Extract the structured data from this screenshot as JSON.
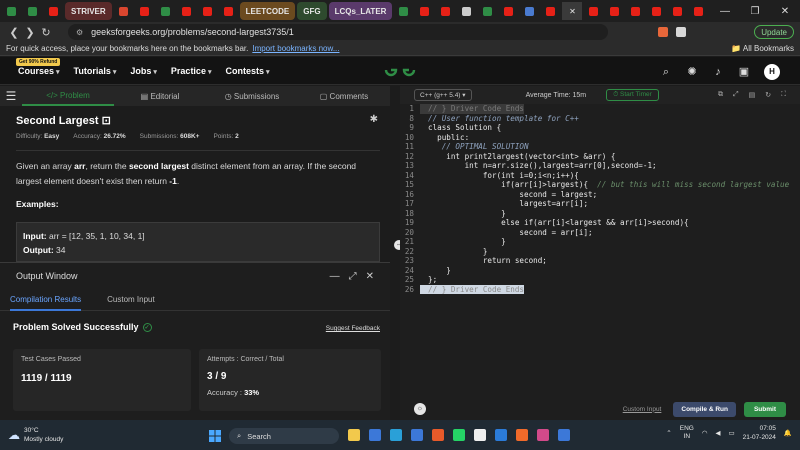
{
  "browser": {
    "tabs": [
      {
        "kind": "icon",
        "icon": "gfg-icon",
        "color": "#2f8d46"
      },
      {
        "kind": "icon",
        "icon": "gfg-icon",
        "color": "#2f8d46"
      },
      {
        "kind": "icon",
        "icon": "youtube-icon",
        "color": "#e62117"
      },
      {
        "kind": "named",
        "label": "STRIVER",
        "color": "#5a2a2a"
      },
      {
        "kind": "icon",
        "icon": "app-icon",
        "color": "#d9462f"
      },
      {
        "kind": "icon",
        "icon": "youtube-icon",
        "color": "#e62117"
      },
      {
        "kind": "icon",
        "icon": "gfg-icon",
        "color": "#2f8d46"
      },
      {
        "kind": "icon",
        "icon": "youtube-icon",
        "color": "#e62117"
      },
      {
        "kind": "icon",
        "icon": "youtube-icon",
        "color": "#e62117"
      },
      {
        "kind": "icon",
        "icon": "youtube-icon",
        "color": "#e62117"
      },
      {
        "kind": "named",
        "label": "LEETCODE",
        "color": "#6b4a1f"
      },
      {
        "kind": "named",
        "label": "GFG",
        "color": "#2e4a2e"
      },
      {
        "kind": "named",
        "label": "LCQs_LATER",
        "color": "#5a3a6b"
      },
      {
        "kind": "icon",
        "icon": "gfg-icon",
        "color": "#2f8d46"
      },
      {
        "kind": "icon",
        "icon": "youtube-icon",
        "color": "#e62117"
      },
      {
        "kind": "icon",
        "icon": "youtube-icon",
        "color": "#e62117"
      },
      {
        "kind": "icon",
        "icon": "page-icon",
        "color": "#cccccc"
      },
      {
        "kind": "icon",
        "icon": "gfg-icon",
        "color": "#2f8d46"
      },
      {
        "kind": "icon",
        "icon": "youtube-icon",
        "color": "#e62117"
      },
      {
        "kind": "icon",
        "icon": "app-icon",
        "color": "#4a7bd0"
      },
      {
        "kind": "icon",
        "icon": "youtube-icon",
        "color": "#e62117"
      },
      {
        "kind": "icon",
        "icon": "youtube-icon",
        "color": "#e62117"
      },
      {
        "kind": "icon",
        "icon": "youtube-icon",
        "color": "#e62117"
      },
      {
        "kind": "icon",
        "icon": "youtube-icon",
        "color": "#e62117"
      },
      {
        "kind": "icon",
        "icon": "youtube-icon",
        "color": "#e62117"
      },
      {
        "kind": "icon",
        "icon": "youtube-icon",
        "color": "#e62117"
      },
      {
        "kind": "icon",
        "icon": "youtube-icon",
        "color": "#e62117"
      }
    ],
    "active_tab_close": "✕",
    "window_controls": [
      "—",
      "❐",
      "✕"
    ],
    "url": "geeksforgeeks.org/problems/second-largest3735/1",
    "update_label": "Update",
    "bookmarks_text": "For quick access, place your bookmarks here on the bookmarks bar.",
    "bookmarks_link": "Import bookmarks now...",
    "all_bookmarks": "All Bookmarks"
  },
  "gfg_nav": {
    "refund_badge": "Get 90% Refund",
    "items": [
      "Courses",
      "Tutorials",
      "Jobs",
      "Practice",
      "Contests"
    ],
    "avatar": "H"
  },
  "problem": {
    "tabs": [
      "Problem",
      "Editorial",
      "Submissions",
      "Comments"
    ],
    "title": "Second Largest",
    "difficulty_label": "Difficulty:",
    "difficulty": "Easy",
    "accuracy_label": "Accuracy:",
    "accuracy": "26.72%",
    "submissions_label": "Submissions:",
    "submissions": "608K+",
    "points_label": "Points:",
    "points": "2",
    "desc_1": "Given an array ",
    "desc_arr": "arr",
    "desc_2": ", return the ",
    "desc_bold": "second largest",
    "desc_3": " distinct element from an array. If the second largest element doesn't exist then return ",
    "desc_neg": "-1",
    "desc_4": ".",
    "examples_label": "Examples:",
    "input_label": "Input:",
    "input_value": " arr = [12, 35, 1, 10, 34, 1]",
    "output_label": "Output:",
    "output_value": " 34"
  },
  "output_window": {
    "title": "Output Window",
    "tabs": [
      "Compilation Results",
      "Custom Input"
    ],
    "status": "Problem Solved Successfully",
    "suggest": "Suggest Feedback",
    "cases_label": "Test Cases Passed",
    "cases_value": "1119 / 1119",
    "attempts_label": "Attempts : Correct / Total",
    "attempts_value": "3 / 9",
    "accuracy_label": "Accuracy : ",
    "accuracy_value": "33%"
  },
  "editor": {
    "language": "C++ (g++ 5.4)",
    "avg_time": "Average Time: 15m",
    "timer": "Start Timer",
    "lines": [
      {
        "n": "1",
        "t": "// } Driver Code Ends",
        "cls": "hl1"
      },
      {
        "n": "8",
        "t": "// User function template for C++",
        "cls": "cmt2"
      },
      {
        "n": "9",
        "t": "class Solution {",
        "cls": ""
      },
      {
        "n": "10",
        "t": "  public:",
        "cls": ""
      },
      {
        "n": "11",
        "t": "   // OPTIMAL SOLUTION",
        "cls": "cmt2"
      },
      {
        "n": "12",
        "t": "    int print2largest(vector<int> &arr) {",
        "cls": ""
      },
      {
        "n": "13",
        "t": "        int n=arr.size(),largest=arr[0],second=-1;",
        "cls": ""
      },
      {
        "n": "14",
        "t": "            for(int i=0;i<n;i++){",
        "cls": ""
      },
      {
        "n": "15",
        "t": "                if(arr[i]>largest){  // but this will miss second largest value",
        "cls": "mixed"
      },
      {
        "n": "16",
        "t": "                    second = largest;",
        "cls": ""
      },
      {
        "n": "17",
        "t": "                    largest=arr[i];",
        "cls": ""
      },
      {
        "n": "18",
        "t": "                }",
        "cls": ""
      },
      {
        "n": "19",
        "t": "                else if(arr[i]<largest && arr[i]>second){",
        "cls": ""
      },
      {
        "n": "20",
        "t": "                    second = arr[i];",
        "cls": ""
      },
      {
        "n": "21",
        "t": "                }",
        "cls": ""
      },
      {
        "n": "22",
        "t": "            }",
        "cls": ""
      },
      {
        "n": "23",
        "t": "            return second;",
        "cls": ""
      },
      {
        "n": "24",
        "t": "    }",
        "cls": ""
      },
      {
        "n": "25",
        "t": "};",
        "cls": ""
      },
      {
        "n": "26",
        "t": "// } Driver Code Ends",
        "cls": "hl"
      }
    ],
    "custom_input": "Custom Input",
    "compile_run": "Compile & Run",
    "submit": "Submit"
  },
  "taskbar": {
    "temp": "30°C",
    "weather": "Mostly cloudy",
    "search_placeholder": "Search",
    "apps": [
      {
        "icon": "folder-icon",
        "color": "#f2c94c"
      },
      {
        "icon": "store-icon",
        "color": "#3c78d8"
      },
      {
        "icon": "edge-icon",
        "color": "#2aa0d8"
      },
      {
        "icon": "mail-icon",
        "color": "#3c78d8"
      },
      {
        "icon": "brave-icon",
        "color": "#e85a2a"
      },
      {
        "icon": "whatsapp-icon",
        "color": "#25d366"
      },
      {
        "icon": "notion-icon",
        "color": "#eeeeee"
      },
      {
        "icon": "todo-icon",
        "color": "#2b7bd8"
      },
      {
        "icon": "app-icon",
        "color": "#f06a2a"
      },
      {
        "icon": "app-icon",
        "color": "#d24a8a"
      },
      {
        "icon": "app-icon",
        "color": "#3c78d8"
      }
    ],
    "lang": "ENG",
    "region": "IN",
    "time": "07:05",
    "date": "21-07-2024"
  }
}
